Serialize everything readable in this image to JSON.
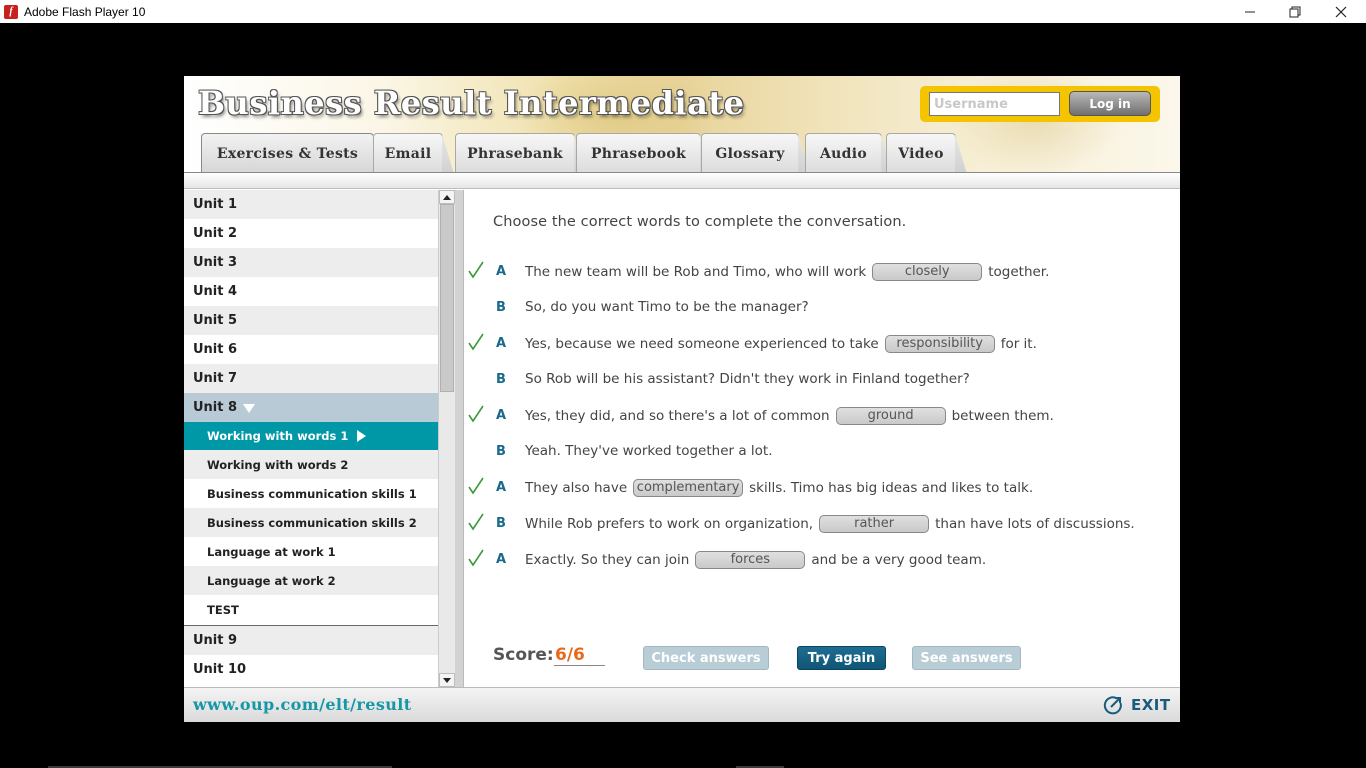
{
  "window": {
    "title": "Adobe Flash Player 10",
    "icon": "flash-icon",
    "controls": [
      "minimize",
      "restore",
      "close"
    ]
  },
  "header": {
    "app_title": "Business Result Intermediate",
    "username_placeholder": "Username",
    "username_value": "",
    "login_label": "Log in",
    "accent_color": "#f5c400"
  },
  "tabs": [
    {
      "label": "Exercises & Tests",
      "active": true
    },
    {
      "label": "Email",
      "active": false
    },
    {
      "label": "Phrasebank",
      "active": false
    },
    {
      "label": "Phrasebook",
      "active": false
    },
    {
      "label": "Glossary",
      "active": false
    },
    {
      "label": "Audio",
      "active": false
    },
    {
      "label": "Video",
      "active": false
    }
  ],
  "sidebar": {
    "units": [
      "Unit 1",
      "Unit 2",
      "Unit 3",
      "Unit 4",
      "Unit 5",
      "Unit 6",
      "Unit 7"
    ],
    "open_unit": "Unit 8",
    "sub_items": [
      "Working with words 1",
      "Working with words 2",
      "Business communication skills 1",
      "Business communication skills 2",
      "Language at work 1",
      "Language at work 2",
      "TEST"
    ],
    "active_sub_item": "Working with words 1",
    "after_units": [
      "Unit 9",
      "Unit 10"
    ]
  },
  "exercise": {
    "instruction": "Choose the correct words to complete the conversation.",
    "lines": [
      {
        "speaker": "A",
        "checked": true,
        "before": "The new team will be Rob and Timo, who will work",
        "gap": "closely",
        "after": "together."
      },
      {
        "speaker": "B",
        "checked": false,
        "before": "So, do you want Timo to be the manager?",
        "gap": "",
        "after": ""
      },
      {
        "speaker": "A",
        "checked": true,
        "before": "Yes, because we need someone experienced to take",
        "gap": "responsibility",
        "after": "for it."
      },
      {
        "speaker": "B",
        "checked": false,
        "before": "So Rob will be his assistant? Didn't they work in Finland together?",
        "gap": "",
        "after": ""
      },
      {
        "speaker": "A",
        "checked": true,
        "before": "Yes, they did, and so there's a lot of common",
        "gap": "ground",
        "after": "between them."
      },
      {
        "speaker": "B",
        "checked": false,
        "before": "Yeah. They've worked together a lot.",
        "gap": "",
        "after": ""
      },
      {
        "speaker": "A",
        "checked": true,
        "before": "They also have",
        "gap": "complementary",
        "after": "skills. Timo has big ideas and likes to talk."
      },
      {
        "speaker": "B",
        "checked": true,
        "before": "While Rob prefers to work on organization,",
        "gap": "rather",
        "after": "than have lots of discussions."
      },
      {
        "speaker": "A",
        "checked": true,
        "before": "Exactly. So they can join",
        "gap": "forces",
        "after": "and be a very good team."
      }
    ],
    "score_label": "Score:",
    "score_value": "6/6",
    "check_answers_label": "Check answers",
    "try_again_label": "Try again",
    "see_answers_label": "See answers"
  },
  "footer": {
    "url": "www.oup.com/elt/result",
    "exit_label": "EXIT"
  },
  "colors": {
    "teal_active": "#0097a7",
    "score_orange": "#e8691e",
    "check_green": "#3c9a3c",
    "primary_button": "#175f82"
  }
}
